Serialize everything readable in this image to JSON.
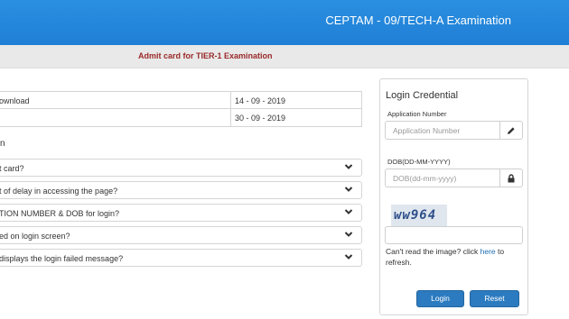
{
  "header": {
    "title": "CEPTAM - 09/TECH-A Examination"
  },
  "subheader": {
    "title": "Admit card for TIER-1 Examination"
  },
  "schedule": [
    {
      "label": "ownload",
      "date": "14 - 09 - 2019"
    },
    {
      "label": "",
      "date": "30 - 09 - 2019"
    }
  ],
  "faq": {
    "heading": "n",
    "items": [
      "t card?",
      "t of delay in accessing the page?",
      "TION NUMBER & DOB for login?",
      "ed on login screen?",
      "displays the login failed message?"
    ]
  },
  "login": {
    "title": "Login Credential",
    "app_label": "Application Number",
    "app_placeholder": "Application Number",
    "dob_label": "DOB(DD-MM-YYYY)",
    "dob_placeholder": "DOB(dd-mm-yyyy)",
    "captcha_text": "ww964",
    "help_prefix": "Can't read the image? click ",
    "help_link": "here",
    "help_suffix": " to refresh.",
    "login_label": "Login",
    "reset_label": "Reset"
  },
  "colors": {
    "header": "#1f7fd6",
    "accent": "#2c7bc0",
    "subtitle": "#9a2a2a"
  },
  "icons": {
    "app_addon": "pencil-icon",
    "dob_addon": "lock-icon",
    "faq_toggle": "chevron-down-icon"
  }
}
